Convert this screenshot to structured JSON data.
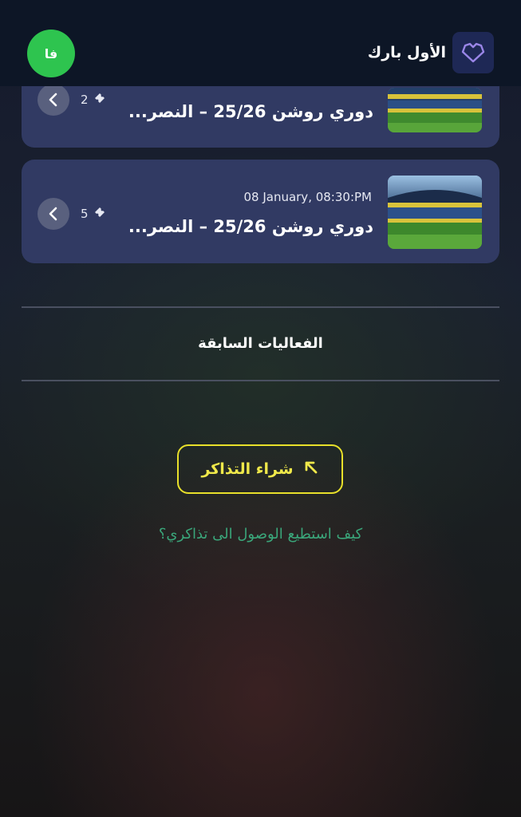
{
  "header": {
    "avatar_initials": "فا",
    "brand_name": "الأول بارك",
    "brand_icon": "heart-outline-icon"
  },
  "events": [
    {
      "date": "",
      "title": "دوري روشن 25/26 – النصر...",
      "ticket_count": "2",
      "ticket_icon": "ticket-icon",
      "chevron_icon": "chevron-left-icon"
    },
    {
      "date": "08 January, 08:30:PM",
      "title": "دوري روشن 25/26 – النصر...",
      "ticket_count": "5",
      "ticket_icon": "ticket-icon",
      "chevron_icon": "chevron-left-icon"
    }
  ],
  "past_events_label": "الفعاليات السابقة",
  "buy_tickets": {
    "label": "شراء التذاكر",
    "icon": "arrow-up-left-icon"
  },
  "help_link": "كيف استطيع الوصول الى تذاكري؟",
  "colors": {
    "header_bg": "#0d1626",
    "card_bg": "#313a63",
    "avatar": "#2ec44f",
    "buy_accent": "#e8e02a",
    "help_link": "#3aa67a"
  }
}
